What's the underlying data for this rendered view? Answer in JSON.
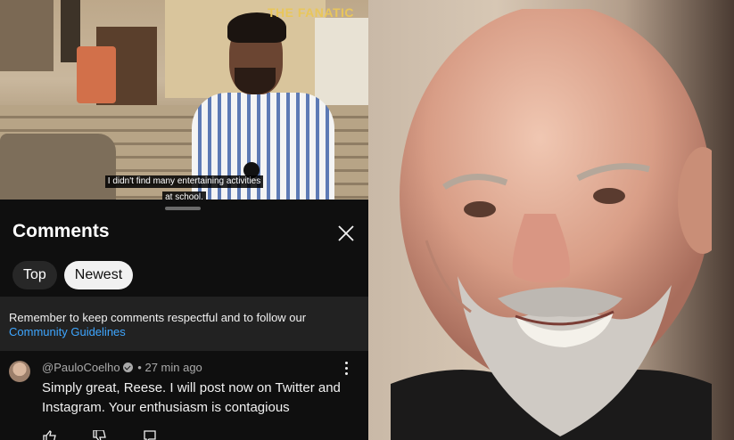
{
  "video": {
    "brand": "THE FANATIC",
    "subtitle_line1": "I didn't find many entertaining activities",
    "subtitle_line2": "at school."
  },
  "comments_panel": {
    "title": "Comments",
    "close_icon": "close-icon",
    "filters": [
      {
        "label": "Top",
        "selected": false
      },
      {
        "label": "Newest",
        "selected": true
      }
    ],
    "notice": {
      "text": "Remember to keep comments respectful and to follow our",
      "link": "Community Guidelines"
    },
    "comment": {
      "author": "@PauloCoelho",
      "verified": true,
      "time": "27 min ago",
      "separator": "•",
      "text": "Simply great, Reese. I will post now on Twitter and Instagram. Your enthusiasm is contagious",
      "actions": [
        "thumbs-up-icon",
        "thumbs-down-icon",
        "reply-icon"
      ]
    }
  },
  "colors": {
    "background": "#0f0f0f",
    "notice_bg": "#222222",
    "link": "#3ea6ff",
    "chip_selected": "#f1f1f1",
    "chip_default": "#272727",
    "brand": "#e9c65a"
  }
}
